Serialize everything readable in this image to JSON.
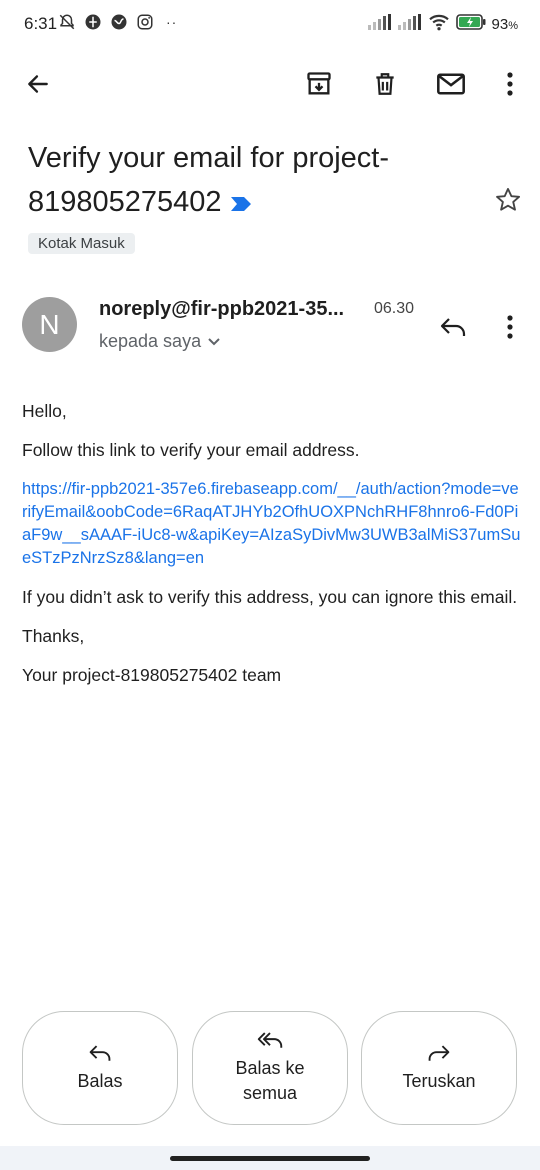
{
  "status_bar": {
    "time": "6:31",
    "battery_percent": "93",
    "battery_suffix": "%",
    "more_dots": "··"
  },
  "toolbar": {
    "back": "arrow-left-icon",
    "archive": "archive-icon",
    "delete": "trash-icon",
    "mark_unread": "mail-icon",
    "more": "more-vert-icon"
  },
  "email": {
    "subject": "Verify your email for project-819805275402",
    "label": "Kotak Masuk",
    "avatar_letter": "N",
    "sender": "noreply@fir-ppb2021-35...",
    "time": "06.30",
    "recipient": "kepada saya",
    "body": {
      "greeting": "Hello,",
      "instruction": "Follow this link to verify your email address.",
      "link": "https://fir-ppb2021-357e6.firebaseapp.com/__/auth/action?mode=verifyEmail&oobCode=6RaqATJHYb2OfhUOXPNchRHF8hnro6-Fd0PiaF9w__sAAAF-iUc8-w&apiKey=AIzaSyDivMw3UWB3alMiS37umSueSTzPzNrzSz8&lang=en",
      "disclaimer": "If you didn’t ask to verify this address, you can ignore this email.",
      "thanks": "Thanks,",
      "signature": "Your project-819805275402 team"
    }
  },
  "actions": {
    "reply": "Balas",
    "reply_all": "Balas ke semua",
    "forward": "Teruskan"
  },
  "colors": {
    "link": "#1a73e8",
    "importance_marker": "#1a73e8",
    "avatar_bg": "#9e9e9e",
    "label_chip_bg": "#eceff1",
    "battery_green": "#34a853"
  }
}
